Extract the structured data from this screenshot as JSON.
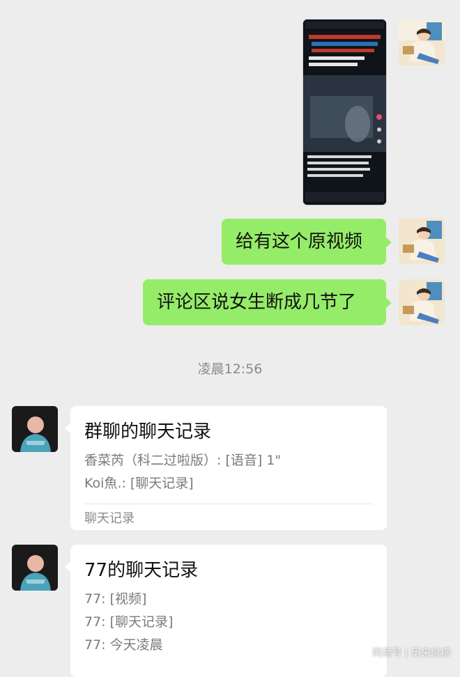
{
  "messages_sent": [
    {
      "type": "image",
      "description_label": "video screenshot"
    },
    {
      "type": "text",
      "text": "给有这个原视频"
    },
    {
      "type": "text",
      "text": "评论区说女生断成几节了"
    }
  ],
  "timestamp": "凌晨12:56",
  "cards": [
    {
      "title": "群聊的聊天记录",
      "lines": [
        "香菜芮（科二过啦版）: [语音] 1\"",
        "Koi魚.: [聊天记录]"
      ],
      "footer": "聊天记录"
    },
    {
      "title": "77的聊天记录",
      "lines": [
        "77: [视频]",
        "77: [聊天记录]",
        "77: 今天凌晨"
      ],
      "footer": ""
    }
  ],
  "watermark": "网易号 | 历来纵横",
  "colors": {
    "sent_bubble": "#95ec69",
    "background": "#ededed",
    "card": "#ffffff"
  }
}
